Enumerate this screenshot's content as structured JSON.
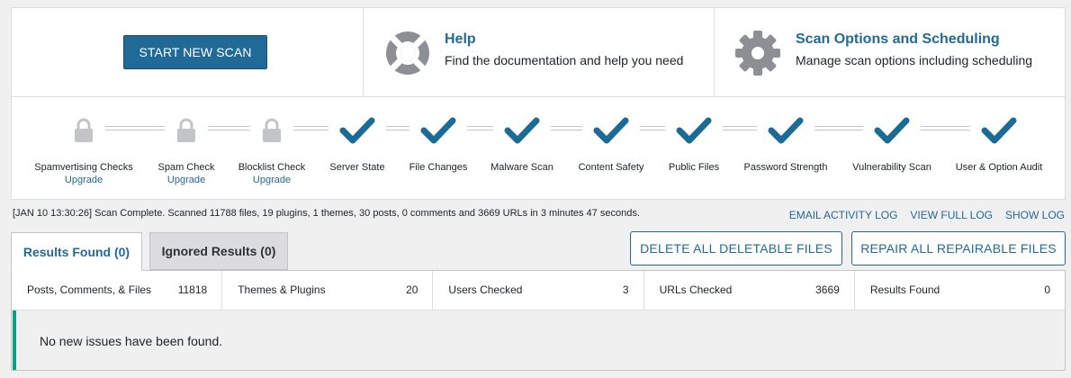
{
  "top": {
    "start_button": "START NEW SCAN",
    "help": {
      "title": "Help",
      "desc": "Find the documentation and help you need",
      "icon": "lifebuoy-icon"
    },
    "scan_options": {
      "title": "Scan Options and Scheduling",
      "desc": "Manage scan options including scheduling",
      "icon": "gear-icon"
    }
  },
  "stages": [
    {
      "label": "Spamvertising Checks",
      "status": "locked",
      "link": "Upgrade"
    },
    {
      "label": "Spam Check",
      "status": "locked",
      "link": "Upgrade"
    },
    {
      "label": "Blocklist Check",
      "status": "locked",
      "link": "Upgrade"
    },
    {
      "label": "Server State",
      "status": "complete"
    },
    {
      "label": "File Changes",
      "status": "complete"
    },
    {
      "label": "Malware Scan",
      "status": "complete"
    },
    {
      "label": "Content Safety",
      "status": "complete"
    },
    {
      "label": "Public Files",
      "status": "complete"
    },
    {
      "label": "Password Strength",
      "status": "complete"
    },
    {
      "label": "Vulnerability Scan",
      "status": "complete"
    },
    {
      "label": "User & Option Audit",
      "status": "complete"
    }
  ],
  "status_line": "[JAN 10 13:30:26] Scan Complete. Scanned 11788 files, 19 plugins, 1 themes, 30 posts, 0 comments and 3669 URLs in 3 minutes 47 seconds.",
  "log_links": {
    "email": "EMAIL ACTIVITY LOG",
    "full": "VIEW FULL LOG",
    "show": "SHOW LOG"
  },
  "tabs": {
    "results": "Results Found (0)",
    "ignored": "Ignored Results (0)"
  },
  "actions": {
    "delete": "DELETE ALL DELETABLE FILES",
    "repair": "REPAIR ALL REPAIRABLE FILES"
  },
  "summary": [
    {
      "label": "Posts, Comments, & Files",
      "value": "11818"
    },
    {
      "label": "Themes & Plugins",
      "value": "20"
    },
    {
      "label": "Users Checked",
      "value": "3"
    },
    {
      "label": "URLs Checked",
      "value": "3669"
    },
    {
      "label": "Results Found",
      "value": "0"
    }
  ],
  "no_issues": "No new issues have been found.",
  "colors": {
    "accent": "#216a98",
    "check": "#1a6b96",
    "lock": "#c3c4c7",
    "success": "#00a386"
  }
}
